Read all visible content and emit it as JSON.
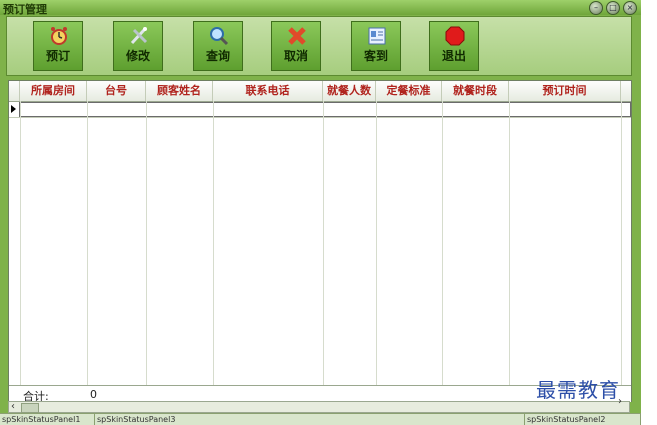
{
  "window": {
    "title": "预订管理"
  },
  "toolbar": [
    {
      "label": "预订",
      "icon": "alarm-clock-icon"
    },
    {
      "label": "修改",
      "icon": "edit-tools-icon"
    },
    {
      "label": "查询",
      "icon": "magnifier-icon"
    },
    {
      "label": "取消",
      "icon": "cancel-x-icon"
    },
    {
      "label": "客到",
      "icon": "guest-card-icon"
    },
    {
      "label": "退出",
      "icon": "stop-sign-icon"
    }
  ],
  "grid": {
    "columns": [
      "所属房间",
      "台号",
      "顾客姓名",
      "联系电话",
      "就餐人数",
      "定餐标准",
      "就餐时段",
      "预订时间"
    ],
    "footer": {
      "total_label": "合计:",
      "total_value": "0"
    }
  },
  "statusbar": {
    "panels": [
      "spSkinStatusPanel1",
      "spSkinStatusPanel3",
      "spSkinStatusPanel2"
    ]
  },
  "watermark": "最需教育",
  "colors": {
    "header_text": "#b0231d",
    "window_green": "#7fb24a",
    "toolbar_button": "#6aaa38"
  }
}
